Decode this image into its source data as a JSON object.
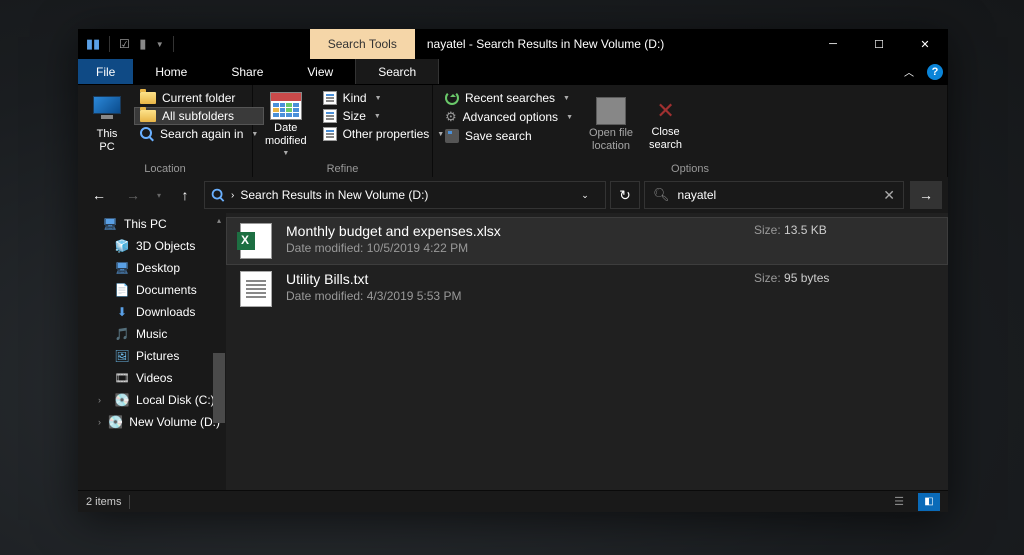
{
  "titlebar": {
    "context_tab": "Search Tools",
    "title": "nayatel - Search Results in New Volume (D:)"
  },
  "menubar": {
    "file": "File",
    "tabs": [
      "Home",
      "Share",
      "View",
      "Search"
    ],
    "active_index": 3
  },
  "ribbon": {
    "groups": [
      {
        "label": "Location",
        "thispc": "This\nPC",
        "items": [
          "Current folder",
          "All subfolders",
          "Search again in"
        ]
      },
      {
        "label": "Refine",
        "date": "Date\nmodified",
        "items": [
          "Kind",
          "Size",
          "Other properties"
        ]
      },
      {
        "label": "Options",
        "items": [
          "Recent searches",
          "Advanced options",
          "Save search"
        ],
        "openfile": "Open file\nlocation",
        "close": "Close\nsearch"
      }
    ]
  },
  "navbar": {
    "breadcrumb": "Search Results in New Volume (D:)",
    "search_value": "nayatel"
  },
  "tree": {
    "root": "This PC",
    "items": [
      {
        "icon": "cube",
        "label": "3D Objects"
      },
      {
        "icon": "desktop",
        "label": "Desktop"
      },
      {
        "icon": "doc",
        "label": "Documents"
      },
      {
        "icon": "download",
        "label": "Downloads"
      },
      {
        "icon": "music",
        "label": "Music"
      },
      {
        "icon": "pictures",
        "label": "Pictures"
      },
      {
        "icon": "videos",
        "label": "Videos"
      },
      {
        "icon": "disk",
        "label": "Local Disk (C:)"
      },
      {
        "icon": "disk",
        "label": "New Volume (D:)"
      }
    ]
  },
  "results": [
    {
      "type": "xlsx",
      "name": "Monthly budget and expenses.xlsx",
      "modified_label": "Date modified:",
      "modified": "10/5/2019 4:22 PM",
      "size_label": "Size:",
      "size": "13.5 KB",
      "selected": true
    },
    {
      "type": "txt",
      "name": "Utility Bills.txt",
      "modified_label": "Date modified:",
      "modified": "4/3/2019 5:53 PM",
      "size_label": "Size:",
      "size": "95 bytes",
      "selected": false
    }
  ],
  "statusbar": {
    "count": "2 items"
  }
}
